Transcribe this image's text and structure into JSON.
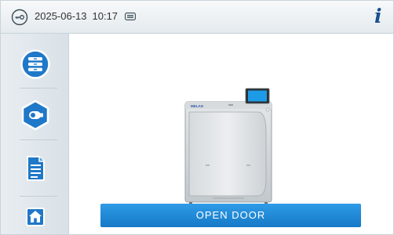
{
  "status_bar": {
    "date": "2025-06-13",
    "time": "10:17",
    "icons": [
      "key-icon",
      "card-icon",
      "info-icon"
    ]
  },
  "sidebar": {
    "items": [
      {
        "icon": "programs-icon"
      },
      {
        "icon": "options-icon"
      },
      {
        "icon": "protocol-icon"
      },
      {
        "icon": "home-icon"
      }
    ]
  },
  "main": {
    "device_brand": "MELAG",
    "open_door_label": "OPEN DOOR"
  },
  "colors": {
    "accent_blue": "#1b86d8",
    "icon_blue": "#1f78c8"
  }
}
